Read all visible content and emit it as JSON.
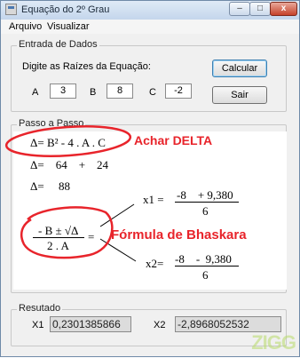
{
  "window": {
    "title": "Equação do 2º Grau"
  },
  "titlebar_buttons": {
    "minimize": "–",
    "maximize": "□",
    "close": "x"
  },
  "menu": {
    "items": [
      "Arquivo",
      "Visualizar"
    ]
  },
  "entrada": {
    "group_title": "Entrada de Dados",
    "prompt": "Digite as Raízes da Equação:",
    "a_label": "A",
    "a_value": "3",
    "b_label": "B",
    "b_value": "8",
    "c_label": "C",
    "c_value": "-2",
    "calcular_label": "Calcular",
    "sair_label": "Sair"
  },
  "passo": {
    "group_title": "Passo a Passo",
    "delta_formula": "Δ= B² - 4 . A . C",
    "delta_line2": "Δ=    64    +    24",
    "delta_line3": "Δ=     88",
    "x1_label": "x1 =",
    "x1_numerator": "-8    + 9,380",
    "x1_denominator": "6",
    "x2_label": "x2=",
    "x2_numerator": "-8    -  9,380",
    "x2_denominator": "6",
    "bhaskara_numerator": "- B ± √Δ",
    "bhaskara_denominator": "2 . A",
    "equals": "="
  },
  "resultado": {
    "group_title": "Resutado",
    "x1_label": "X1",
    "x1_value": "0,2301385866",
    "x2_label": "X2",
    "x2_value": "-2,8968052532"
  },
  "annotations": {
    "achar_delta": "Achar DELTA",
    "formula_bhaskara": "Fórmula de Bhaskara",
    "color": "#e8242b"
  },
  "watermark": "ZIGG"
}
